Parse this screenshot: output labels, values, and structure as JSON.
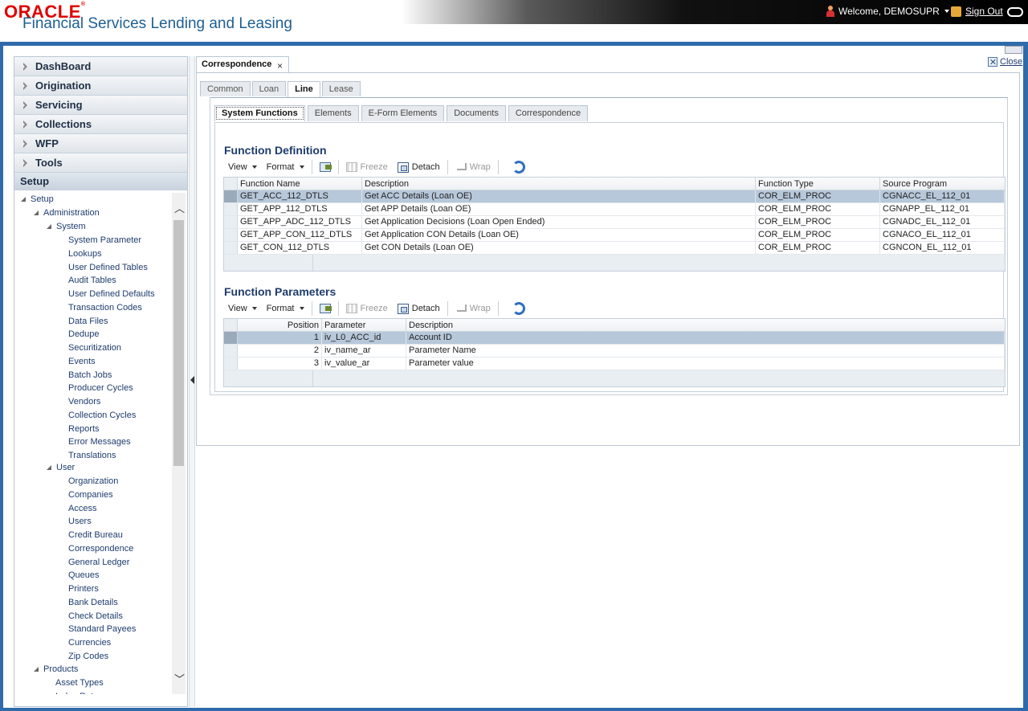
{
  "header": {
    "logo_text": "ORACLE",
    "app_title": "Financial Services Lending and Leasing",
    "welcome": "Welcome, DEMOSUPR",
    "signout": "Sign Out"
  },
  "nav": {
    "accordion": [
      "DashBoard",
      "Origination",
      "Servicing",
      "Collections",
      "WFP",
      "Tools"
    ],
    "setup_label": "Setup",
    "tree": {
      "root": "Setup",
      "administration": "Administration",
      "system": "System",
      "system_items": [
        "System Parameter",
        "Lookups",
        "User Defined Tables",
        "Audit Tables",
        "User Defined Defaults",
        "Transaction Codes",
        "Data Files",
        "Dedupe",
        "Securitization",
        "Events",
        "Batch Jobs",
        "Producer Cycles",
        "Vendors",
        "Collection Cycles",
        "Reports",
        "Error Messages",
        "Translations"
      ],
      "user": "User",
      "user_items": [
        "Organization",
        "Companies",
        "Access",
        "Users",
        "Credit Bureau",
        "Correspondence",
        "General Ledger",
        "Queues",
        "Printers",
        "Bank Details",
        "Check Details",
        "Standard Payees",
        "Currencies",
        "Zip Codes"
      ],
      "products": "Products",
      "products_items": [
        "Asset Types",
        "Index Rates"
      ]
    }
  },
  "main": {
    "doc_tab": "Correspondence",
    "close_label": "Close",
    "tabs": [
      "Common",
      "Loan",
      "Line",
      "Lease"
    ],
    "active_tab": "Line",
    "subtabs": [
      "System Functions",
      "Elements",
      "E-Form Elements",
      "Documents",
      "Correspondence"
    ],
    "active_subtab": "System Functions",
    "toolbar": {
      "view": "View",
      "format": "Format",
      "freeze": "Freeze",
      "detach": "Detach",
      "wrap": "Wrap"
    },
    "function_definition": {
      "title": "Function Definition",
      "columns": [
        "Function Name",
        "Description",
        "Function Type",
        "Source Program"
      ],
      "rows": [
        [
          "GET_ACC_112_DTLS",
          "Get ACC Details (Loan OE)",
          "COR_ELM_PROC",
          "CGNACC_EL_112_01"
        ],
        [
          "GET_APP_112_DTLS",
          "Get APP Details (Loan OE)",
          "COR_ELM_PROC",
          "CGNAPP_EL_112_01"
        ],
        [
          "GET_APP_ADC_112_DTLS",
          "Get Application Decisions (Loan Open Ended)",
          "COR_ELM_PROC",
          "CGNADC_EL_112_01"
        ],
        [
          "GET_APP_CON_112_DTLS",
          "Get Application CON Details (Loan OE)",
          "COR_ELM_PROC",
          "CGNACO_EL_112_01"
        ],
        [
          "GET_CON_112_DTLS",
          "Get CON Details (Loan OE)",
          "COR_ELM_PROC",
          "CGNCON_EL_112_01"
        ]
      ],
      "selected_row": 0
    },
    "function_parameters": {
      "title": "Function Parameters",
      "columns": [
        "Position",
        "Parameter",
        "Description"
      ],
      "rows": [
        [
          "1",
          "iv_L0_ACC_id",
          "Account ID"
        ],
        [
          "2",
          "iv_name_ar",
          "Parameter Name"
        ],
        [
          "3",
          "iv_value_ar",
          "Parameter value"
        ]
      ],
      "selected_row": 0
    }
  }
}
